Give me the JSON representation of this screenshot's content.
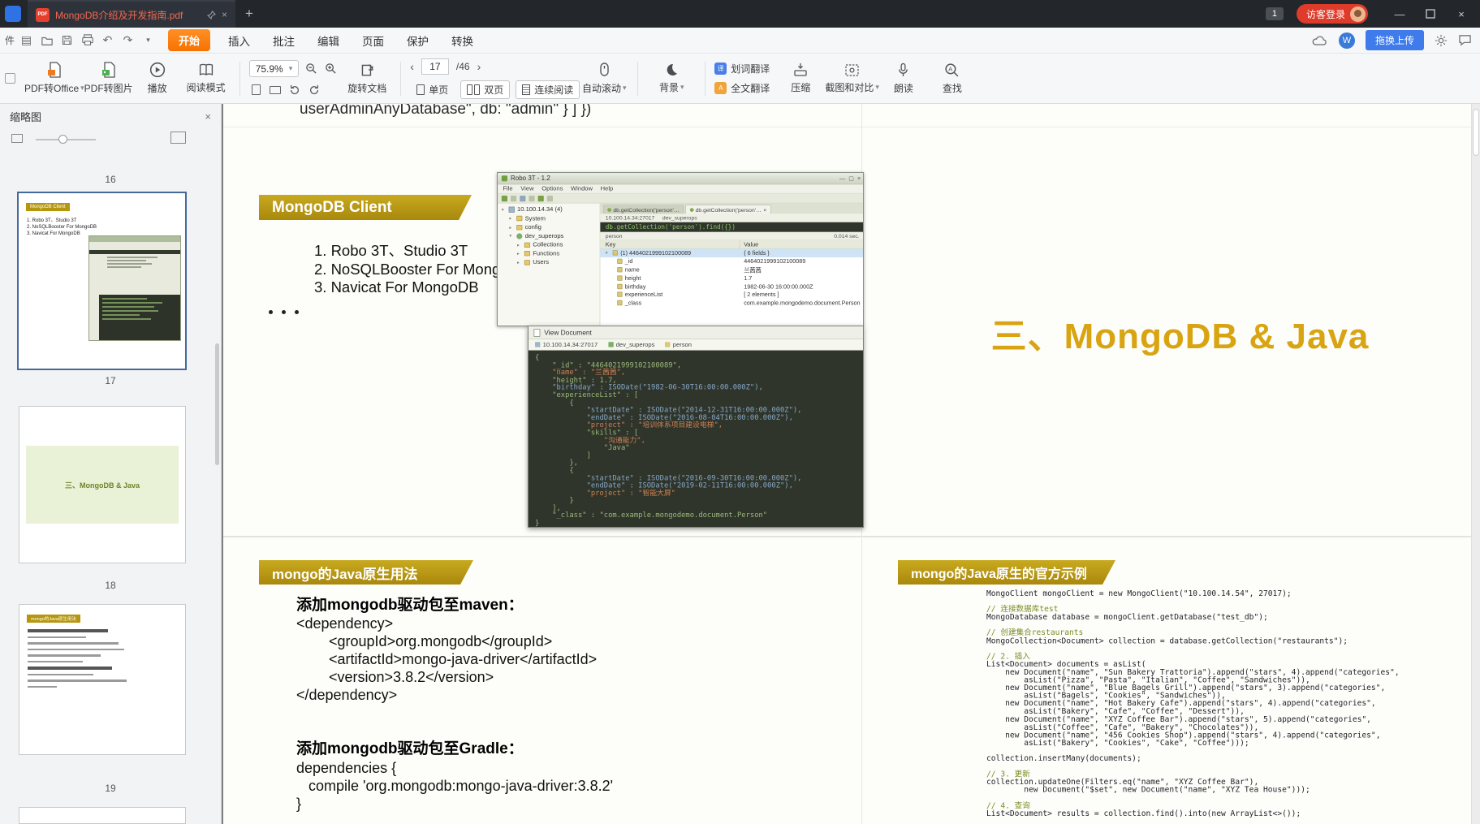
{
  "icons": {
    "pdf_tab": "PDF",
    "close": "×",
    "minimize": "—",
    "plus": "+",
    "caret": "▾",
    "prev": "‹",
    "next": "›",
    "word_translate": "译",
    "full_translate": "A",
    "wps_cloud": "W"
  },
  "titlebar": {
    "tab_title": "MongoDB介绍及开发指南.pdf",
    "tab_count_badge": "1",
    "login_label": "访客登录"
  },
  "menubar": {
    "edge_fragment": "件",
    "items": [
      "开始",
      "插入",
      "批注",
      "编辑",
      "页面",
      "保护",
      "转换"
    ],
    "upload_label": "拖换上传"
  },
  "toolbar": {
    "pdf_to_office": "PDF转Office",
    "pdf_to_image": "PDF转图片",
    "play": "播放",
    "read_mode": "阅读模式",
    "zoom_value": "75.9%",
    "rotate_doc": "旋转文档",
    "page_current": "17",
    "page_total": "/46",
    "single_page": "单页",
    "double_page": "双页",
    "continuous_read": "连续阅读",
    "auto_scroll": "自动滚动",
    "background": "背景",
    "word_translate": "划词翻译",
    "full_translate": "全文翻译",
    "compress": "压缩",
    "snapshot_compare": "截图和对比",
    "read_aloud": "朗读",
    "find": "查找"
  },
  "sidebar": {
    "title": "缩略图",
    "page_labels": [
      "16",
      "17",
      "18",
      "19"
    ],
    "thumb17_badge": "MongoDB Client",
    "thumb17_lines": [
      "1. Robo 3T、Studio 3T",
      "2. NoSQLBooster For MongoDB",
      "3. Navicat For MongoDB"
    ],
    "thumb18_title": "三、MongoDB & Java",
    "thumb19_badge": "mongo的Java原生用法"
  },
  "page": {
    "top_fragment": "userAdminAnyDatabase\", db: \"admin\" } ] })",
    "slide17": {
      "badge": "MongoDB Client",
      "items": [
        "1. Robo 3T、Studio 3T",
        "2. NoSQLBooster For MongoDB",
        "3. Navicat For MongoDB"
      ]
    },
    "slide18": {
      "title": "三、MongoDB & Java"
    },
    "slide19": {
      "badge": "mongo的Java原生用法",
      "maven_heading": "添加mongodb驱动包至maven：",
      "maven_code": [
        "<dependency>",
        "        <groupId>org.mongodb</groupId>",
        "        <artifactId>mongo-java-driver</artifactId>",
        "        <version>3.8.2</version>",
        "</dependency>"
      ],
      "gradle_heading": "添加mongodb驱动包至Gradle：",
      "gradle_code": [
        "dependencies {",
        "   compile 'org.mongodb:mongo-java-driver:3.8.2'",
        "}"
      ]
    },
    "slide20": {
      "badge": "mongo的Java原生的官方示例",
      "code": [
        "MongoClient mongoClient = new MongoClient(\"10.100.14.54\", 27017);",
        "",
        "// 连接数据库test",
        "MongoDatabase database = mongoClient.getDatabase(\"test_db\");",
        "",
        "// 创建集合restaurants",
        "MongoCollection<Document> collection = database.getCollection(\"restaurants\");",
        "",
        "// 2. 插入",
        "List<Document> documents = asList(",
        "    new Document(\"name\", \"Sun Bakery Trattoria\").append(\"stars\", 4).append(\"categories\",",
        "        asList(\"Pizza\", \"Pasta\", \"Italian\", \"Coffee\", \"Sandwiches\")),",
        "    new Document(\"name\", \"Blue Bagels Grill\").append(\"stars\", 3).append(\"categories\",",
        "        asList(\"Bagels\", \"Cookies\", \"Sandwiches\")),",
        "    new Document(\"name\", \"Hot Bakery Cafe\").append(\"stars\", 4).append(\"categories\",",
        "        asList(\"Bakery\", \"Cafe\", \"Coffee\", \"Dessert\")),",
        "    new Document(\"name\", \"XYZ Coffee Bar\").append(\"stars\", 5).append(\"categories\",",
        "        asList(\"Coffee\", \"Cafe\", \"Bakery\", \"Chocolates\")),",
        "    new Document(\"name\", \"456 Cookies Shop\").append(\"stars\", 4).append(\"categories\",",
        "        asList(\"Bakery\", \"Cookies\", \"Cake\", \"Coffee\")));",
        "",
        "collection.insertMany(documents);",
        "",
        "// 3. 更新",
        "collection.updateOne(Filters.eq(\"name\", \"XYZ Coffee Bar\"),",
        "        new Document(\"$set\", new Document(\"name\", \"XYZ Tea House\")));",
        "",
        "// 4. 查询",
        "List<Document> results = collection.find().into(new ArrayList<>());"
      ]
    }
  },
  "robo": {
    "title": "Robo 3T - 1.2",
    "menu": [
      "File",
      "View",
      "Options",
      "Window",
      "Help"
    ],
    "tree": [
      "10.100.14.34 (4)",
      "System",
      "config",
      "dev_superops",
      "Collections",
      "Functions",
      "Users"
    ],
    "tabs": [
      "db.getCollection('person'…",
      "db.getCollection('person'…"
    ],
    "conn": [
      "10.100.14.34:27017",
      "dev_superops"
    ],
    "query": "db.getCollection('person').find({})",
    "result_name": "person",
    "result_time": "0.014 sec.",
    "columns": [
      "Key",
      "Value"
    ],
    "rows": [
      {
        "key": "(1) 4464021999102100089",
        "value": "{ 6 fields }"
      },
      {
        "key": "_id",
        "value": "4464021999102100089"
      },
      {
        "key": "name",
        "value": "兰茜茜"
      },
      {
        "key": "height",
        "value": "1.7"
      },
      {
        "key": "birthday",
        "value": "1982-06-30 16:00:00.000Z"
      },
      {
        "key": "experienceList",
        "value": "[ 2 elements ]"
      },
      {
        "key": "_class",
        "value": "com.example.mongodemo.document.Person"
      }
    ],
    "viewdoc": {
      "title": "View Document",
      "crumbs": [
        "10.100.14.34:27017",
        "dev_superops",
        "person"
      ],
      "json": [
        "{",
        "    \"_id\" : \"4464021999102100089\",",
        "    \"name\" : \"兰茜茜\",",
        "    \"height\" : 1.7,",
        "    \"birthday\" : ISODate(\"1982-06-30T16:00:00.000Z\"),",
        "    \"experienceList\" : [",
        "        {",
        "            \"startDate\" : ISODate(\"2014-12-31T16:00:00.000Z\"),",
        "            \"endDate\" : ISODate(\"2016-08-04T16:00:00.000Z\"),",
        "            \"project\" : \"培训体系项目建设电梯\",",
        "            \"skills\" : [",
        "                \"沟通能力\",",
        "                \"Java\"",
        "            ]",
        "        },",
        "        {",
        "            \"startDate\" : ISODate(\"2016-09-30T16:00:00.000Z\"),",
        "            \"endDate\" : ISODate(\"2019-02-11T16:00:00.000Z\"),",
        "            \"project\" : \"智能大屏\"",
        "        }",
        "    ],",
        "    \"_class\" : \"com.example.mongodemo.document.Person\"",
        "}"
      ]
    }
  }
}
